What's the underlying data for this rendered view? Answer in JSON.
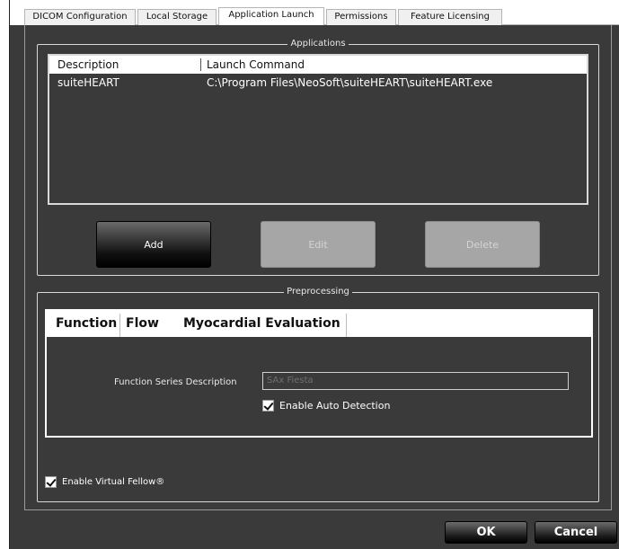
{
  "tabs": [
    "DICOM Configuration",
    "Local Storage",
    "Application Launch",
    "Permissions",
    "Feature Licensing"
  ],
  "active_tab": "Application Launch",
  "applications": {
    "legend": "Applications",
    "columns": [
      "Description",
      "Launch Command"
    ],
    "rows": [
      {
        "description": "suiteHEART",
        "command": "C:\\Program Files\\NeoSoft\\suiteHEART\\suiteHEART.exe"
      }
    ],
    "buttons": {
      "add": "Add",
      "edit": "Edit",
      "delete": "Delete"
    }
  },
  "preprocessing": {
    "legend": "Preprocessing",
    "subtabs": [
      "Function",
      "Flow",
      "Myocardial Evaluation"
    ],
    "active_subtab": "Function",
    "series_label": "Function Series Description",
    "series_value": "SAx Fiesta",
    "auto_detection_label": "Enable Auto Detection",
    "auto_detection_checked": true,
    "virtual_fellow_label": "Enable Virtual Fellow®",
    "virtual_fellow_checked": true
  },
  "footer": {
    "ok": "OK",
    "cancel": "Cancel"
  },
  "colors": {
    "background": "#3a3a3a",
    "text": "#e8e8e8",
    "disabled_button": "#a6a6a6"
  }
}
